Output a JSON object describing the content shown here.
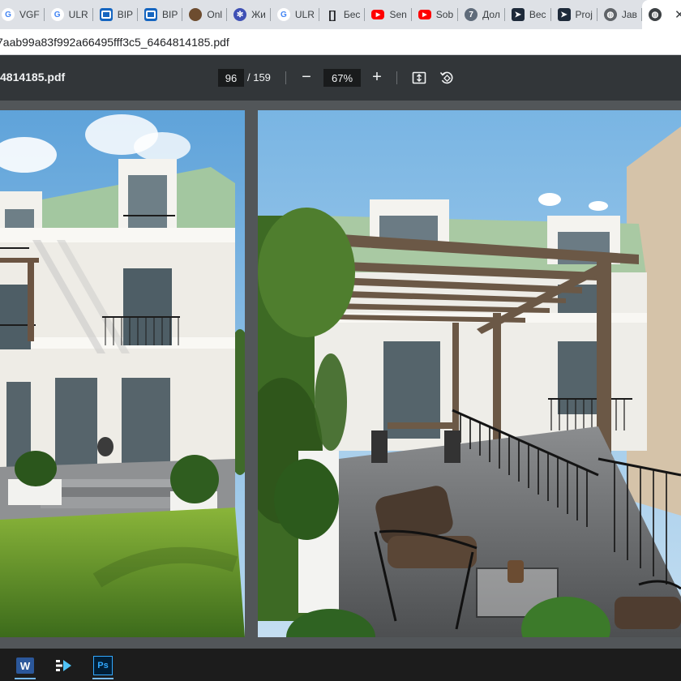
{
  "browser": {
    "tabs": [
      {
        "label": "VGF",
        "icon": "google-g-icon"
      },
      {
        "label": "ULR",
        "icon": "google-g-icon"
      },
      {
        "label": "BIP",
        "icon": "bip-icon"
      },
      {
        "label": "BIP",
        "icon": "bip-icon"
      },
      {
        "label": "Onl",
        "icon": "coin-icon"
      },
      {
        "label": "Жи",
        "icon": "crest-icon"
      },
      {
        "label": "ULR",
        "icon": "google-g-icon"
      },
      {
        "label": "Бес",
        "icon": "bracket-icon"
      },
      {
        "label": "Sen",
        "icon": "youtube-icon"
      },
      {
        "label": "Sob",
        "icon": "youtube-icon"
      },
      {
        "label": "Дол",
        "icon": "seven-icon"
      },
      {
        "label": "Bec",
        "icon": "cursor-icon"
      },
      {
        "label": "Proj",
        "icon": "cursor-icon"
      },
      {
        "label": "Jaв",
        "icon": "globe-icon"
      }
    ],
    "active_tab_icon": "globe-icon",
    "address": "7aab99a83f992a66495fff3c5_6464814185.pdf"
  },
  "pdf_toolbar": {
    "title": "4814185.pdf",
    "current_page": "96",
    "total_pages": "/ 159",
    "zoom": "67%",
    "zoom_out_label": "−",
    "zoom_in_label": "+"
  },
  "taskbar": {
    "apps": [
      {
        "name": "word",
        "label": "W"
      },
      {
        "name": "app-arrow",
        "label": ""
      },
      {
        "name": "photoshop",
        "label": "Ps"
      }
    ]
  },
  "colors": {
    "tabstrip": "#dee1e6",
    "toolbar": "#323639",
    "viewer": "#525659",
    "taskbar": "#1c1c1c"
  }
}
